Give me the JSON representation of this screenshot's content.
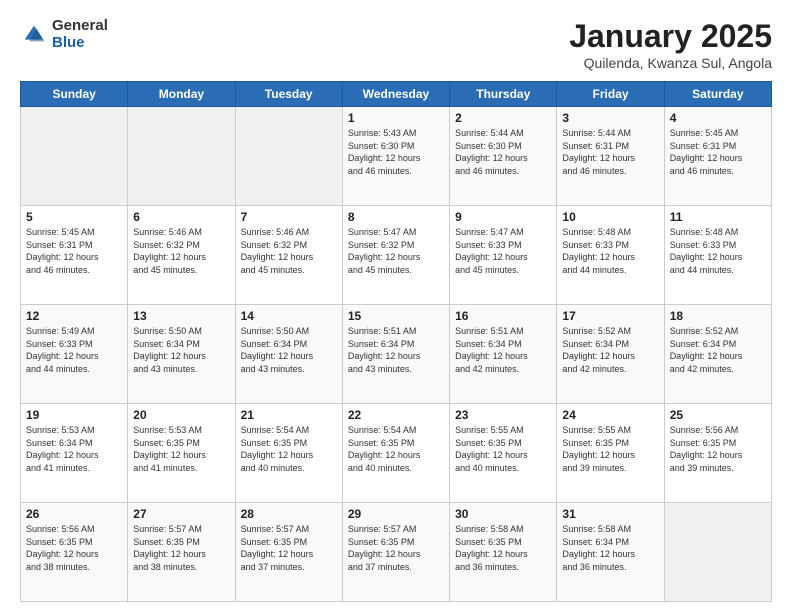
{
  "header": {
    "logo": {
      "general": "General",
      "blue": "Blue"
    },
    "title": "January 2025",
    "location": "Quilenda, Kwanza Sul, Angola"
  },
  "calendar": {
    "days_of_week": [
      "Sunday",
      "Monday",
      "Tuesday",
      "Wednesday",
      "Thursday",
      "Friday",
      "Saturday"
    ],
    "weeks": [
      [
        {
          "day": "",
          "info": ""
        },
        {
          "day": "",
          "info": ""
        },
        {
          "day": "",
          "info": ""
        },
        {
          "day": "1",
          "info": "Sunrise: 5:43 AM\nSunset: 6:30 PM\nDaylight: 12 hours\nand 46 minutes."
        },
        {
          "day": "2",
          "info": "Sunrise: 5:44 AM\nSunset: 6:30 PM\nDaylight: 12 hours\nand 46 minutes."
        },
        {
          "day": "3",
          "info": "Sunrise: 5:44 AM\nSunset: 6:31 PM\nDaylight: 12 hours\nand 46 minutes."
        },
        {
          "day": "4",
          "info": "Sunrise: 5:45 AM\nSunset: 6:31 PM\nDaylight: 12 hours\nand 46 minutes."
        }
      ],
      [
        {
          "day": "5",
          "info": "Sunrise: 5:45 AM\nSunset: 6:31 PM\nDaylight: 12 hours\nand 46 minutes."
        },
        {
          "day": "6",
          "info": "Sunrise: 5:46 AM\nSunset: 6:32 PM\nDaylight: 12 hours\nand 45 minutes."
        },
        {
          "day": "7",
          "info": "Sunrise: 5:46 AM\nSunset: 6:32 PM\nDaylight: 12 hours\nand 45 minutes."
        },
        {
          "day": "8",
          "info": "Sunrise: 5:47 AM\nSunset: 6:32 PM\nDaylight: 12 hours\nand 45 minutes."
        },
        {
          "day": "9",
          "info": "Sunrise: 5:47 AM\nSunset: 6:33 PM\nDaylight: 12 hours\nand 45 minutes."
        },
        {
          "day": "10",
          "info": "Sunrise: 5:48 AM\nSunset: 6:33 PM\nDaylight: 12 hours\nand 44 minutes."
        },
        {
          "day": "11",
          "info": "Sunrise: 5:48 AM\nSunset: 6:33 PM\nDaylight: 12 hours\nand 44 minutes."
        }
      ],
      [
        {
          "day": "12",
          "info": "Sunrise: 5:49 AM\nSunset: 6:33 PM\nDaylight: 12 hours\nand 44 minutes."
        },
        {
          "day": "13",
          "info": "Sunrise: 5:50 AM\nSunset: 6:34 PM\nDaylight: 12 hours\nand 43 minutes."
        },
        {
          "day": "14",
          "info": "Sunrise: 5:50 AM\nSunset: 6:34 PM\nDaylight: 12 hours\nand 43 minutes."
        },
        {
          "day": "15",
          "info": "Sunrise: 5:51 AM\nSunset: 6:34 PM\nDaylight: 12 hours\nand 43 minutes."
        },
        {
          "day": "16",
          "info": "Sunrise: 5:51 AM\nSunset: 6:34 PM\nDaylight: 12 hours\nand 42 minutes."
        },
        {
          "day": "17",
          "info": "Sunrise: 5:52 AM\nSunset: 6:34 PM\nDaylight: 12 hours\nand 42 minutes."
        },
        {
          "day": "18",
          "info": "Sunrise: 5:52 AM\nSunset: 6:34 PM\nDaylight: 12 hours\nand 42 minutes."
        }
      ],
      [
        {
          "day": "19",
          "info": "Sunrise: 5:53 AM\nSunset: 6:34 PM\nDaylight: 12 hours\nand 41 minutes."
        },
        {
          "day": "20",
          "info": "Sunrise: 5:53 AM\nSunset: 6:35 PM\nDaylight: 12 hours\nand 41 minutes."
        },
        {
          "day": "21",
          "info": "Sunrise: 5:54 AM\nSunset: 6:35 PM\nDaylight: 12 hours\nand 40 minutes."
        },
        {
          "day": "22",
          "info": "Sunrise: 5:54 AM\nSunset: 6:35 PM\nDaylight: 12 hours\nand 40 minutes."
        },
        {
          "day": "23",
          "info": "Sunrise: 5:55 AM\nSunset: 6:35 PM\nDaylight: 12 hours\nand 40 minutes."
        },
        {
          "day": "24",
          "info": "Sunrise: 5:55 AM\nSunset: 6:35 PM\nDaylight: 12 hours\nand 39 minutes."
        },
        {
          "day": "25",
          "info": "Sunrise: 5:56 AM\nSunset: 6:35 PM\nDaylight: 12 hours\nand 39 minutes."
        }
      ],
      [
        {
          "day": "26",
          "info": "Sunrise: 5:56 AM\nSunset: 6:35 PM\nDaylight: 12 hours\nand 38 minutes."
        },
        {
          "day": "27",
          "info": "Sunrise: 5:57 AM\nSunset: 6:35 PM\nDaylight: 12 hours\nand 38 minutes."
        },
        {
          "day": "28",
          "info": "Sunrise: 5:57 AM\nSunset: 6:35 PM\nDaylight: 12 hours\nand 37 minutes."
        },
        {
          "day": "29",
          "info": "Sunrise: 5:57 AM\nSunset: 6:35 PM\nDaylight: 12 hours\nand 37 minutes."
        },
        {
          "day": "30",
          "info": "Sunrise: 5:58 AM\nSunset: 6:35 PM\nDaylight: 12 hours\nand 36 minutes."
        },
        {
          "day": "31",
          "info": "Sunrise: 5:58 AM\nSunset: 6:34 PM\nDaylight: 12 hours\nand 36 minutes."
        },
        {
          "day": "",
          "info": ""
        }
      ]
    ]
  }
}
